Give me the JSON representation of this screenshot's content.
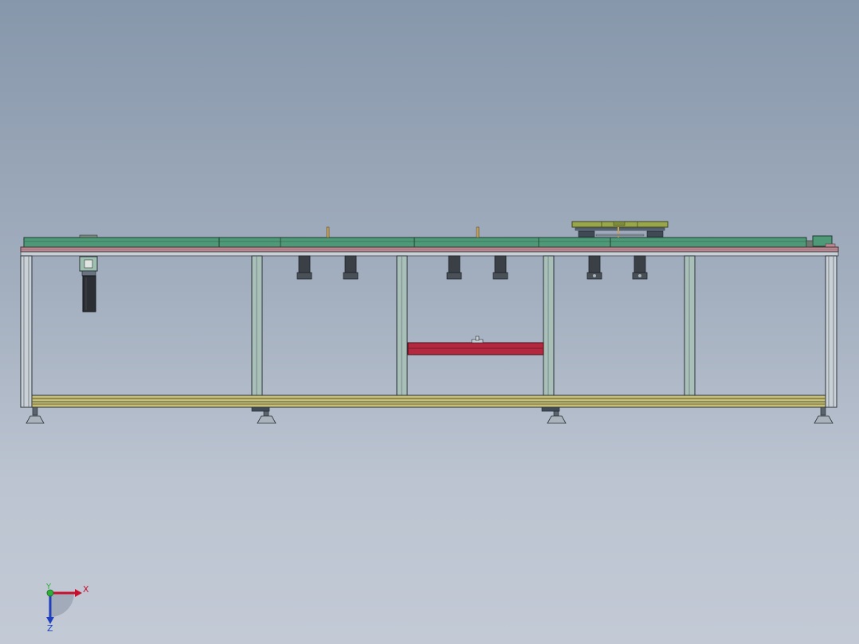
{
  "viewport": {
    "background_top": "#8797ab",
    "background_bottom": "#c3cad6"
  },
  "model": {
    "frame_color": "#3c4548",
    "conveyor_color": "#4e9a78",
    "rail_color": "#b98a92",
    "red_bar_color": "#b3283f",
    "base_rail_color": "#6f6a2f"
  },
  "triad": {
    "x_label": "X",
    "y_label": "Y",
    "z_label": "Z",
    "x_color": "#c8102e",
    "y_color": "#2fae3a",
    "z_color": "#1f3fbf"
  }
}
